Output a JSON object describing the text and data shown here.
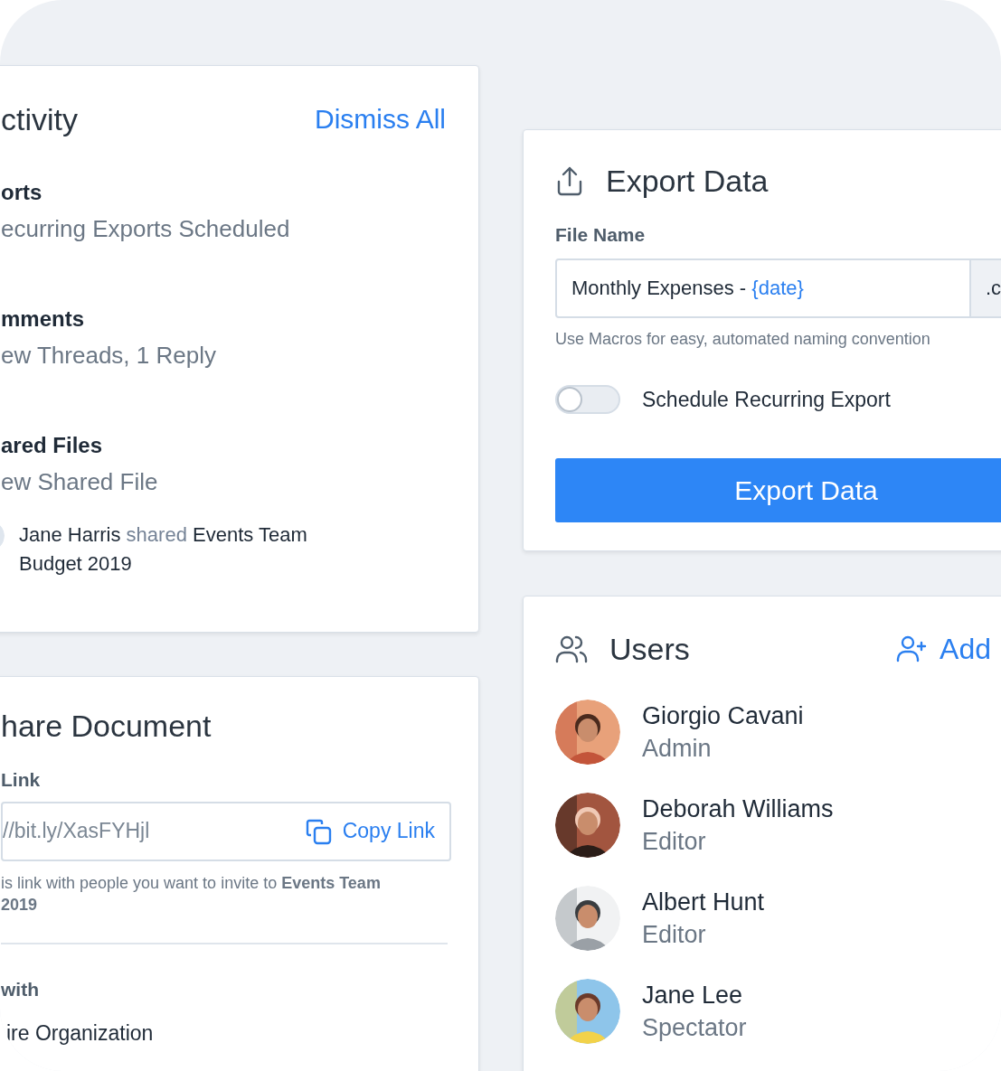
{
  "activity": {
    "title": "ctivity",
    "dismiss": "Dismiss All",
    "groups": [
      {
        "title": "orts",
        "summary": "ecurring Exports Scheduled"
      },
      {
        "title": "mments",
        "summary": "ew Threads, 1 Reply"
      },
      {
        "title": "ared Files",
        "summary": "ew Shared File",
        "events": [
          {
            "actor": "Jane Harris",
            "verb": "shared",
            "object": "Events Team Budget 2019"
          }
        ]
      }
    ]
  },
  "share": {
    "title": "hare Document",
    "link_label": "Link",
    "link": "//bit.ly/XasFYHjl",
    "copy": "Copy Link",
    "note_lines": [
      "is link with people you want to invite to **Events Team**",
      "**2019**"
    ],
    "with_label": "with",
    "options": [
      {
        "label": "ire Organization"
      }
    ]
  },
  "export": {
    "title": "Export Data",
    "file_name_label": "File Name",
    "file_name": "Monthly Expenses - ",
    "macro": "{date}",
    "extension": ".c",
    "help": "Use Macros for easy, automated naming convention",
    "schedule": {
      "label": "Schedule Recurring Export",
      "on": false
    },
    "button": "Export Data"
  },
  "users": {
    "title": "Users",
    "add": "Add",
    "items": [
      {
        "name": "Giorgio Cavani",
        "role": "Admin"
      },
      {
        "name": "Deborah Williams",
        "role": "Editor"
      },
      {
        "name": "Albert Hunt",
        "role": "Editor"
      },
      {
        "name": "Jane Lee",
        "role": "Spectator"
      }
    ]
  }
}
